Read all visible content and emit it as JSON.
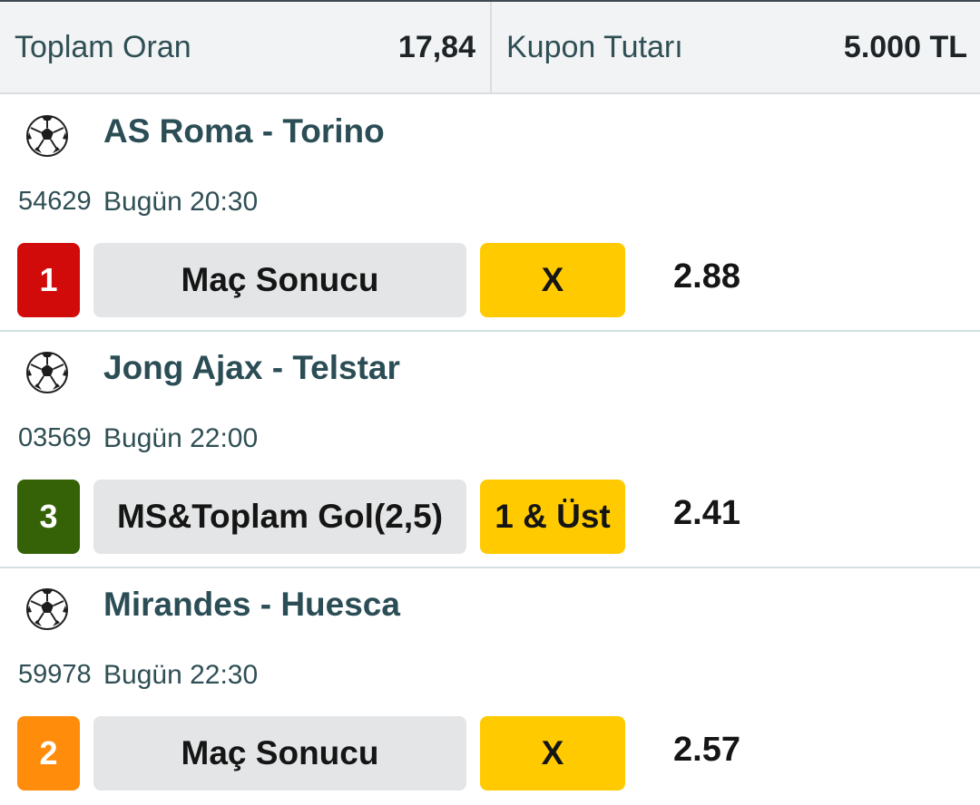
{
  "header": {
    "total_odds_label": "Toplam Oran",
    "total_odds_value": "17,84",
    "coupon_amount_label": "Kupon Tutarı",
    "coupon_amount_value": "5.000 TL"
  },
  "matches": [
    {
      "icon": "soccer-ball-icon",
      "teams": "AS Roma - Torino",
      "code": "54629",
      "time": "Bugün 20:30",
      "number": "1",
      "number_color": "#d10a0a",
      "market": "Maç Sonucu",
      "pick": "X",
      "odd": "2.88"
    },
    {
      "icon": "soccer-ball-icon",
      "teams": "Jong Ajax - Telstar",
      "code": "03569",
      "time": "Bugün 22:00",
      "number": "3",
      "number_color": "#356207",
      "market": "MS&Toplam Gol(2,5)",
      "pick": "1 & Üst",
      "odd": "2.41"
    },
    {
      "icon": "soccer-ball-icon",
      "teams": "Mirandes - Huesca",
      "code": "59978",
      "time": "Bugün 22:30",
      "number": "2",
      "number_color": "#ff8c0a",
      "market": "Maç Sonucu",
      "pick": "X",
      "odd": "2.57"
    }
  ],
  "colors": {
    "pick_bg": "#ffcb00",
    "market_bg": "#e4e5e6",
    "team_text": "#2b4d55"
  }
}
